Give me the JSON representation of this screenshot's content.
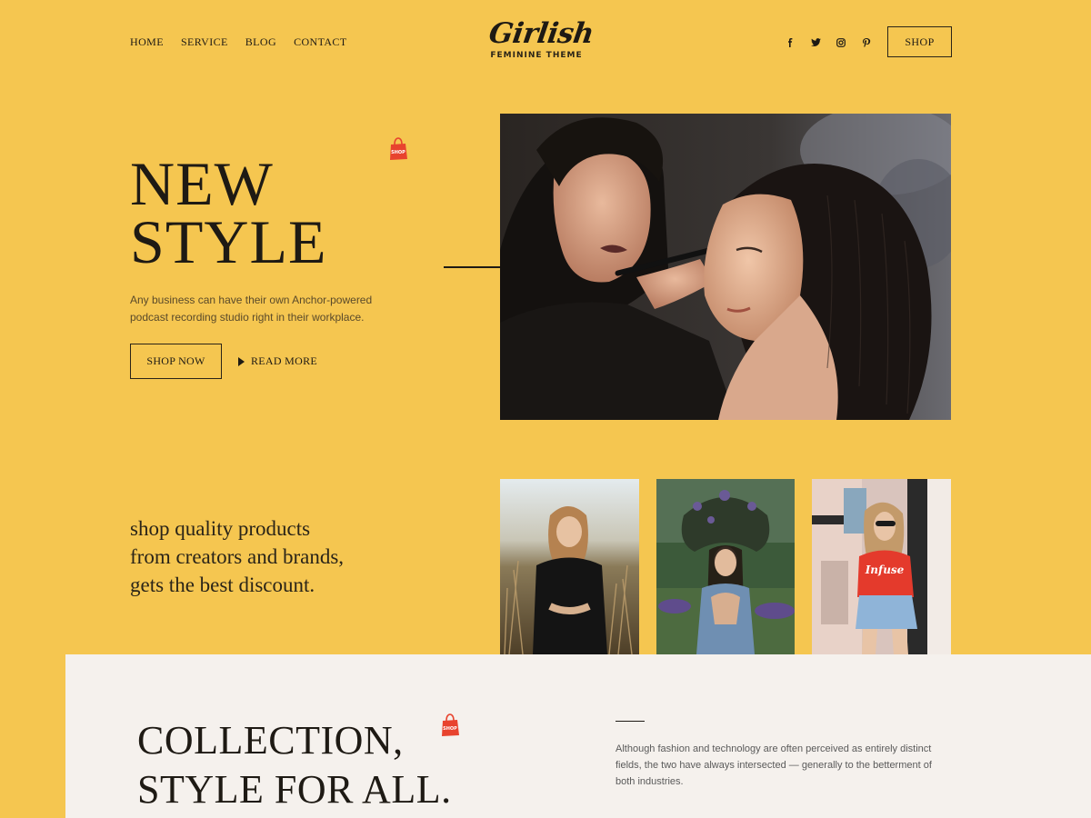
{
  "header": {
    "nav": [
      "HOME",
      "SERVICE",
      "BLOG",
      "CONTACT"
    ],
    "logo": {
      "script": "Girlish",
      "tagline": "FEMININE THEME"
    },
    "social_icons": [
      "facebook-icon",
      "twitter-icon",
      "instagram-icon",
      "pinterest-icon"
    ],
    "shop_label": "SHOP"
  },
  "hero": {
    "title_line1": "NEW",
    "title_line2": "STYLE",
    "description": "Any business can have their own Anchor-powered podcast recording studio right in their workplace.",
    "shop_now_label": "SHOP NOW",
    "read_more_label": "READ MORE",
    "bag_text": "SHOP"
  },
  "promo": {
    "tagline_line1": "shop quality products",
    "tagline_line2": "from creators and brands,",
    "tagline_line3": "gets the best discount.",
    "tshirt_text": "Infuse"
  },
  "collection": {
    "title_line1": "COLLECTION,",
    "title_line2": "STYLE FOR ALL.",
    "description": "Although fashion and technology are often perceived as entirely distinct fields, the two have always intersected — generally to the betterment of both industries."
  },
  "colors": {
    "background": "#f5c650",
    "text": "#1e1a14",
    "section_bg": "#f5f1ed",
    "bag_red": "#e8432e"
  }
}
